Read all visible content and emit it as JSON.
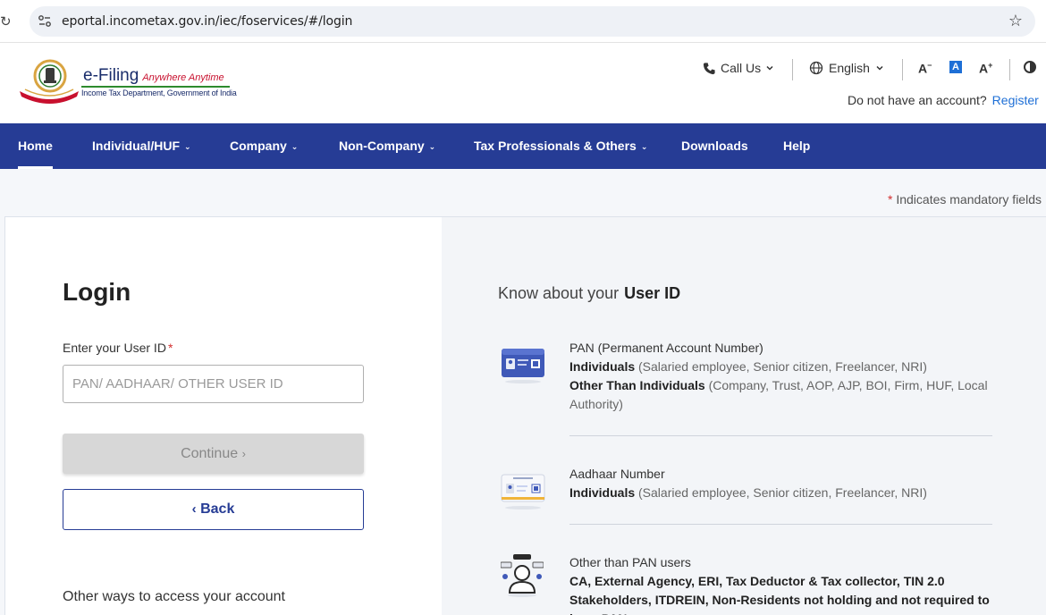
{
  "browser": {
    "url": "eportal.incometax.gov.in/iec/foservices/#/login",
    "reload_icon": "↻",
    "star_icon": "☆"
  },
  "header": {
    "logo_title": "e-Filing",
    "logo_tagline": "Anywhere Anytime",
    "logo_subtitle": "Income Tax Department, Government of India",
    "call_us": "Call Us",
    "language": "English",
    "font_decrease": "A",
    "font_normal": "A",
    "font_increase": "A",
    "account_prompt": "Do not have an account?",
    "register": "Register"
  },
  "nav": {
    "items": [
      {
        "label": "Home",
        "active": true
      },
      {
        "label": "Individual/HUF"
      },
      {
        "label": "Company"
      },
      {
        "label": "Non-Company"
      },
      {
        "label": "Tax Professionals & Others"
      },
      {
        "label": "Downloads"
      },
      {
        "label": "Help"
      }
    ]
  },
  "mandatory_note": "Indicates mandatory fields",
  "login": {
    "title": "Login",
    "userid_label": "Enter your User ID",
    "userid_placeholder": "PAN/ AADHAAR/ OTHER USER ID",
    "continue_label": "Continue",
    "back_label": "Back",
    "other_ways": "Other ways to access your account"
  },
  "know": {
    "title_prefix": "Know about your",
    "title_bold": "User ID",
    "pan": {
      "heading": "PAN (Permanent Account Number)",
      "ind_label": "Individuals",
      "ind_desc": "(Salaried employee, Senior citizen, Freelancer, NRI)",
      "other_label": "Other Than Individuals",
      "other_desc": "(Company, Trust, AOP, AJP, BOI, Firm, HUF, Local Authority)"
    },
    "aadhaar": {
      "heading": "Aadhaar Number",
      "ind_label": "Individuals",
      "ind_desc": "(Salaried employee, Senior citizen, Freelancer, NRI)"
    },
    "other": {
      "heading": "Other than PAN users",
      "desc": "CA, External Agency, ERI, Tax Deductor & Tax collector, TIN 2.0 Stakeholders, ITDREIN, Non-Residents not holding and not required to have PAN"
    }
  },
  "colors": {
    "nav_bg": "#263c95",
    "link": "#1e6fd6",
    "required": "#d32f2f"
  }
}
